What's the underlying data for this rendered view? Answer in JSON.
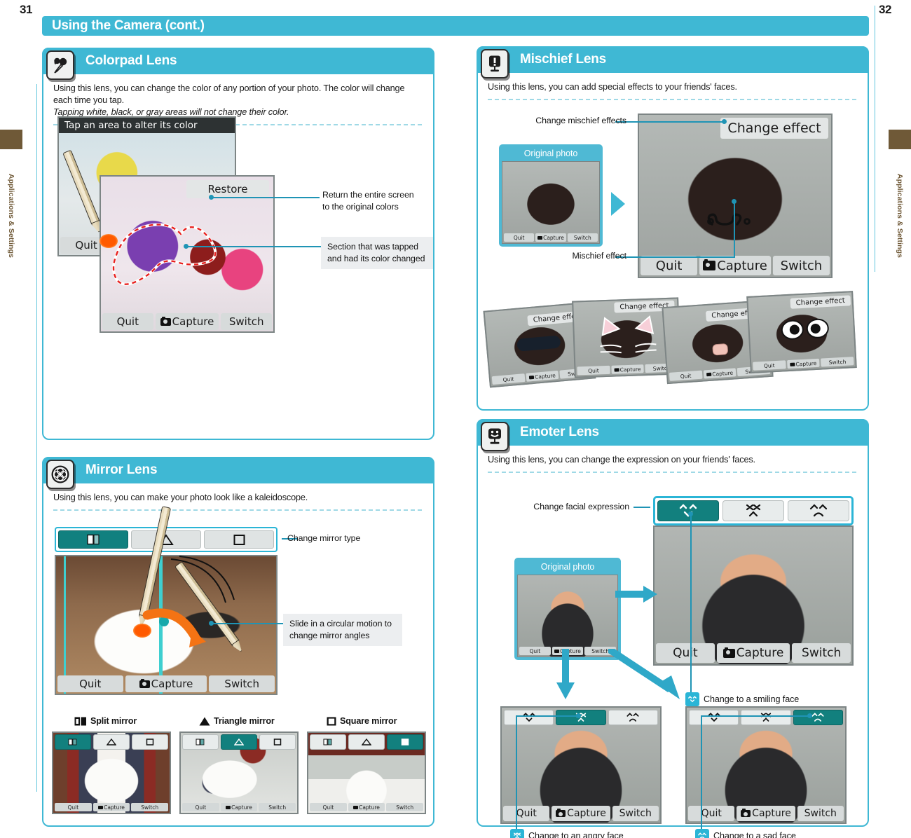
{
  "pages": {
    "left": "31",
    "right": "32"
  },
  "side_tab_label": "Applications & Settings",
  "title": "Using the Camera (cont.)",
  "sections": {
    "colorpad": {
      "icon": "eyedropper-color-icon",
      "title": "Colorpad Lens",
      "desc_line1": "Using this lens, you can change the color of any portion of your photo. The color will change each time you tap.",
      "desc_line2": "Tapping white, black, or gray areas will not change their color.",
      "screen_hint": "Tap an area to alter its color",
      "restore_label": "Restore",
      "buttons": {
        "quit": "Quit",
        "capture": "Capture",
        "switch": "Switch"
      },
      "callout_restore_l1": "Return the entire screen",
      "callout_restore_l2": "to the original colors",
      "callout_section_l1": "Section that was tapped",
      "callout_section_l2": "and had its color changed"
    },
    "mirror": {
      "icon": "kaleidoscope-icon",
      "title": "Mirror Lens",
      "desc": "Using this lens, you can make your photo look like a kaleidoscope.",
      "callout_type": "Change mirror type",
      "callout_slide_l1": "Slide in a circular motion to",
      "callout_slide_l2": "change mirror angles",
      "buttons": {
        "quit": "Quit",
        "capture": "Capture",
        "switch": "Switch"
      },
      "samples": [
        {
          "label": "Split mirror",
          "icon": "split-mirror-icon",
          "selected_index": 0
        },
        {
          "label": "Triangle mirror",
          "icon": "triangle-mirror-icon",
          "selected_index": 1
        },
        {
          "label": "Square mirror",
          "icon": "square-mirror-icon",
          "selected_index": 2
        }
      ]
    },
    "mischief": {
      "icon": "mischief-face-icon",
      "title": "Mischief Lens",
      "desc": "Using this lens, you can add special effects to your friends' faces.",
      "callout_change": "Change mischief effects",
      "callout_effect": "Mischief effect",
      "change_effect_label": "Change effect",
      "original_caption": "Original photo",
      "buttons": {
        "quit": "Quit",
        "capture": "Capture",
        "switch": "Switch"
      },
      "examples": [
        {
          "name": "sunglasses-effect",
          "change_effect_label": "Change effect"
        },
        {
          "name": "cat-ears-effect",
          "change_effect_label": "Change effect"
        },
        {
          "name": "pig-nose-effect",
          "change_effect_label": "Change effect"
        },
        {
          "name": "big-eyes-effect",
          "change_effect_label": "Change effect"
        }
      ]
    },
    "emoter": {
      "icon": "emoter-face-icon",
      "title": "Emoter Lens",
      "desc": "Using this lens, you can change the expression on your friends' faces.",
      "callout_expression": "Change facial expression",
      "original_caption": "Original photo",
      "buttons": {
        "quit": "Quit",
        "capture": "Capture",
        "switch": "Switch"
      },
      "legends": [
        {
          "icon": "smiling-face-icon",
          "label": "Change to a smiling face"
        },
        {
          "icon": "angry-face-icon",
          "label": "Change to an angry face"
        },
        {
          "icon": "sad-face-icon",
          "label": "Change to a sad face"
        }
      ],
      "expressions": [
        "smiling-face-icon",
        "angry-face-icon",
        "sad-face-icon"
      ]
    }
  },
  "colors": {
    "accent": "#3fb8d4",
    "accent_dark": "#1f94b5",
    "selected_button": "#11807f",
    "sidetab_brown": "#6f5937",
    "callout_box": "#eceef0"
  }
}
